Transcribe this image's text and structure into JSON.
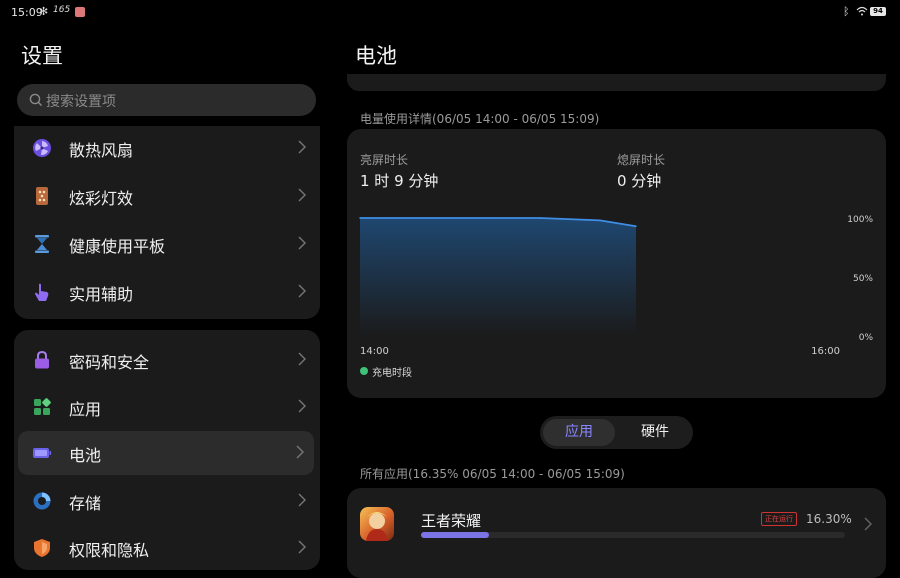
{
  "status_bar": {
    "time": "15:09",
    "refresh_rate": "165",
    "battery_level": "94",
    "icons": [
      "fan-icon",
      "app-notification-icon",
      "bluetooth-icon",
      "wifi-icon",
      "battery-icon"
    ]
  },
  "left": {
    "title": "设置",
    "search_placeholder": "搜索设置项",
    "group1": [
      {
        "label": "散热风扇",
        "icon": "fan-icon",
        "color": "#7a5cf0"
      },
      {
        "label": "炫彩灯效",
        "icon": "light-effect-icon",
        "color": "#c9783e"
      },
      {
        "label": "健康使用平板",
        "icon": "hourglass-icon",
        "color": "#3a79b8"
      },
      {
        "label": "实用辅助",
        "icon": "hand-icon",
        "color": "#8b5cf6"
      }
    ],
    "group2": [
      {
        "label": "密码和安全",
        "icon": "lock-icon",
        "color": "#9b5de5"
      },
      {
        "label": "应用",
        "icon": "apps-icon",
        "color": "#3aa55d"
      },
      {
        "label": "电池",
        "icon": "battery-icon",
        "color": "#6a63e8"
      },
      {
        "label": "存储",
        "icon": "storage-icon",
        "color": "#3a8fe0"
      },
      {
        "label": "权限和隐私",
        "icon": "shield-icon",
        "color": "#e8742e"
      }
    ],
    "selected": "电池"
  },
  "right": {
    "title": "电池",
    "usage_label": "电量使用详情(06/05 14:00 - 06/05 15:09)",
    "screen_on_label": "亮屏时长",
    "screen_on_value": "1 时 9 分钟",
    "screen_off_label": "熄屏时长",
    "screen_off_value": "0 分钟",
    "legend": "充电时段",
    "tabs": {
      "active": "应用",
      "inactive": "硬件"
    },
    "all_apps_label": "所有应用(16.35% 06/05 14:00 - 06/05 15:09)",
    "app": {
      "name": "王者荣耀",
      "badge": "正在运行",
      "percent": "16.30%",
      "bar_fraction": 0.16
    }
  },
  "chart_data": {
    "type": "area",
    "x": [
      "14:00",
      "14:30",
      "14:45",
      "15:00",
      "15:09"
    ],
    "values": [
      100,
      100,
      100,
      98,
      93
    ],
    "x_tick_labels": [
      "14:00",
      "16:00"
    ],
    "y_tick_labels": [
      "100%",
      "50%",
      "0%"
    ],
    "xlim": [
      "14:00",
      "16:00"
    ],
    "ylim": [
      0,
      100
    ],
    "grid": false,
    "line_color": "#3f8ee6",
    "fill_top": "#1f4770",
    "fill_bottom": "#1b1b1b"
  }
}
